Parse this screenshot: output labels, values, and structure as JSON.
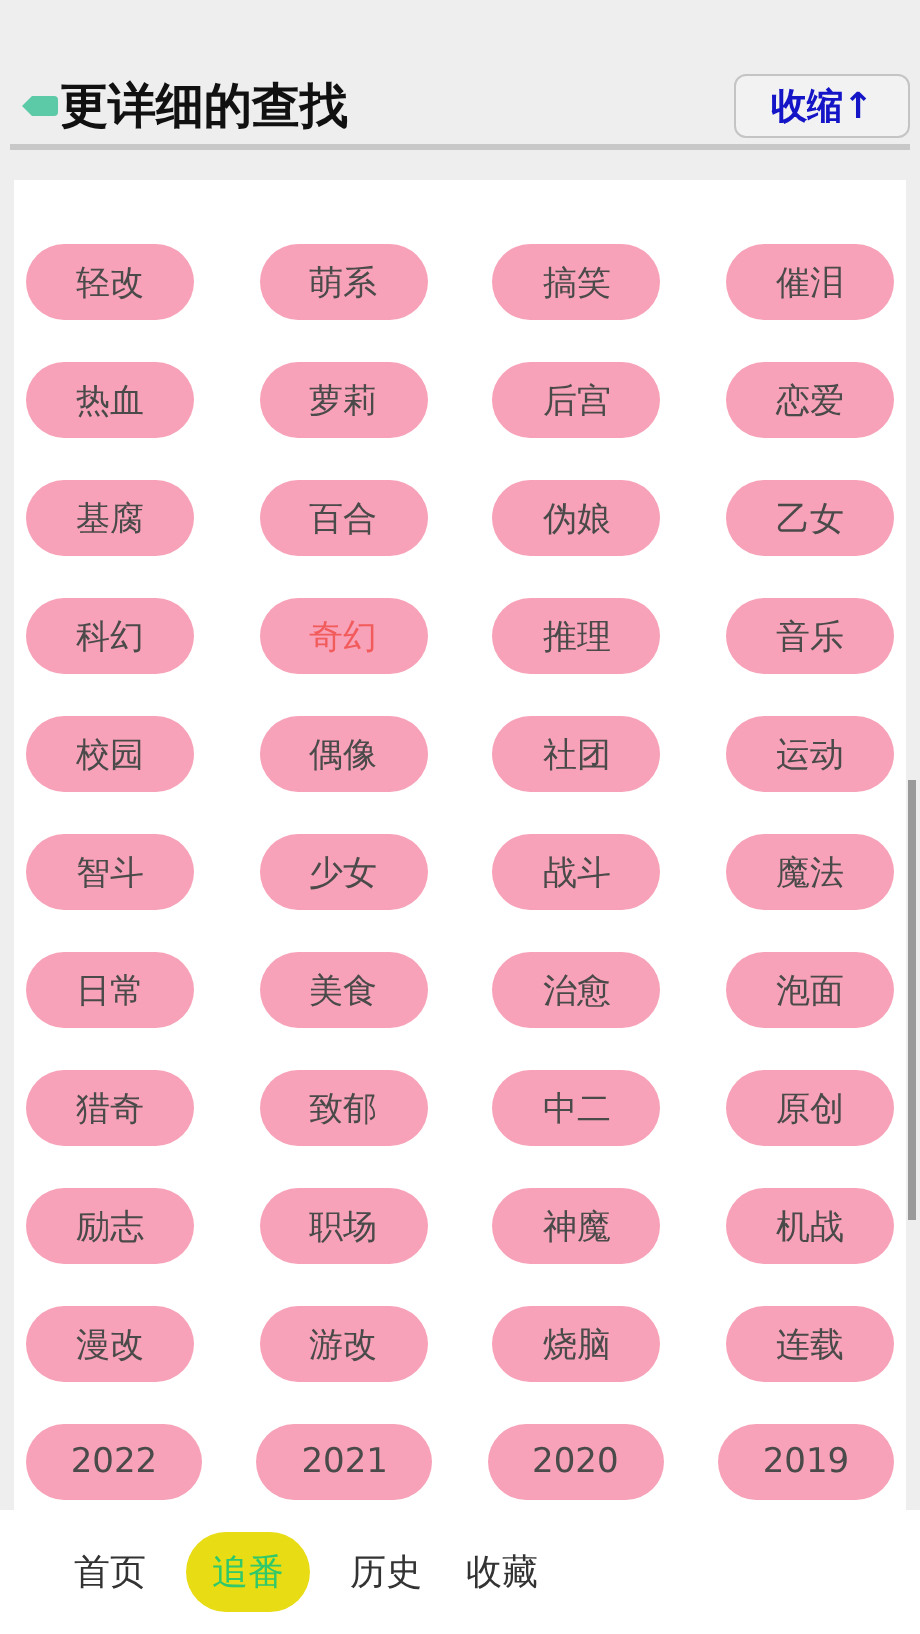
{
  "header": {
    "title": "更详细的查找",
    "collapse_button": "收缩↑"
  },
  "tags": [
    {
      "label": "轻改",
      "selected": false
    },
    {
      "label": "萌系",
      "selected": false
    },
    {
      "label": "搞笑",
      "selected": false
    },
    {
      "label": "催泪",
      "selected": false
    },
    {
      "label": "热血",
      "selected": false
    },
    {
      "label": "萝莉",
      "selected": false
    },
    {
      "label": "后宫",
      "selected": false
    },
    {
      "label": "恋爱",
      "selected": false
    },
    {
      "label": "基腐",
      "selected": false
    },
    {
      "label": "百合",
      "selected": false
    },
    {
      "label": "伪娘",
      "selected": false
    },
    {
      "label": "乙女",
      "selected": false
    },
    {
      "label": "科幻",
      "selected": false
    },
    {
      "label": "奇幻",
      "selected": true
    },
    {
      "label": "推理",
      "selected": false
    },
    {
      "label": "音乐",
      "selected": false
    },
    {
      "label": "校园",
      "selected": false
    },
    {
      "label": "偶像",
      "selected": false
    },
    {
      "label": "社团",
      "selected": false
    },
    {
      "label": "运动",
      "selected": false
    },
    {
      "label": "智斗",
      "selected": false
    },
    {
      "label": "少女",
      "selected": false
    },
    {
      "label": "战斗",
      "selected": false
    },
    {
      "label": "魔法",
      "selected": false
    },
    {
      "label": "日常",
      "selected": false
    },
    {
      "label": "美食",
      "selected": false
    },
    {
      "label": "治愈",
      "selected": false
    },
    {
      "label": "泡面",
      "selected": false
    },
    {
      "label": "猎奇",
      "selected": false
    },
    {
      "label": "致郁",
      "selected": false
    },
    {
      "label": "中二",
      "selected": false
    },
    {
      "label": "原创",
      "selected": false
    },
    {
      "label": "励志",
      "selected": false
    },
    {
      "label": "职场",
      "selected": false
    },
    {
      "label": "神魔",
      "selected": false
    },
    {
      "label": "机战",
      "selected": false
    },
    {
      "label": "漫改",
      "selected": false
    },
    {
      "label": "游改",
      "selected": false
    },
    {
      "label": "烧脑",
      "selected": false
    },
    {
      "label": "连载",
      "selected": false
    },
    {
      "label": "2022",
      "selected": false
    },
    {
      "label": "2021",
      "selected": false
    },
    {
      "label": "2020",
      "selected": false
    },
    {
      "label": "2019",
      "selected": false
    }
  ],
  "bottom_nav": [
    {
      "label": "首页",
      "selected": false
    },
    {
      "label": "追番",
      "selected": true
    },
    {
      "label": "历史",
      "selected": false
    },
    {
      "label": "收藏",
      "selected": false
    }
  ]
}
